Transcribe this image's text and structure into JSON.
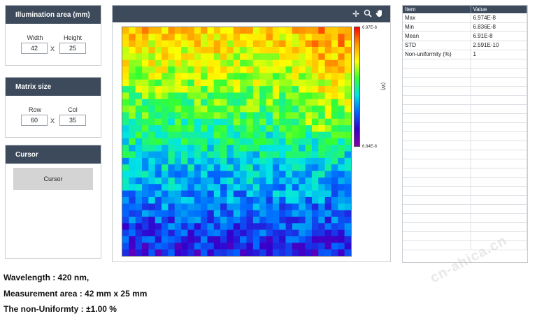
{
  "illumination": {
    "title": "Illumination area (mm)",
    "width_label": "Width",
    "height_label": "Height",
    "width_value": "42",
    "height_value": "25",
    "separator": "X"
  },
  "matrix": {
    "title": "Matrix size",
    "row_label": "Row",
    "col_label": "Col",
    "row_value": "60",
    "col_value": "35",
    "separator": "X"
  },
  "cursor": {
    "title": "Cursor",
    "button_label": "Cursor"
  },
  "toolbar": {
    "icons": [
      "crosshair-icon",
      "zoom-icon",
      "pan-hand-icon"
    ]
  },
  "plot": {
    "colorbar_max_label": "6.97E-8",
    "colorbar_min_label": "6.84E-8",
    "colorbar_unit": "(W)",
    "grid_cols": 35,
    "grid_rows": 35,
    "colors": [
      "#8800aa",
      "#3300cc",
      "#0066ff",
      "#00e5e5",
      "#33ff33",
      "#ffff00",
      "#ff9900",
      "#ff0000"
    ]
  },
  "stats": {
    "headers": [
      "Item",
      "Value"
    ],
    "rows": [
      [
        "Max",
        "6.974E-8"
      ],
      [
        "Min",
        "6.836E-8"
      ],
      [
        "Mean",
        "6.91E-8"
      ],
      [
        "STD",
        "2.591E-10"
      ],
      [
        "Non-uniformity (%)",
        "1"
      ]
    ]
  },
  "info": {
    "line1": "Wavelength : 420 nm,",
    "line2": "Measurement area : 42 mm x 25 mm",
    "line3": "The non-Uniformty :  ±1.00 %"
  },
  "watermark": "cn-ahica.cn"
}
